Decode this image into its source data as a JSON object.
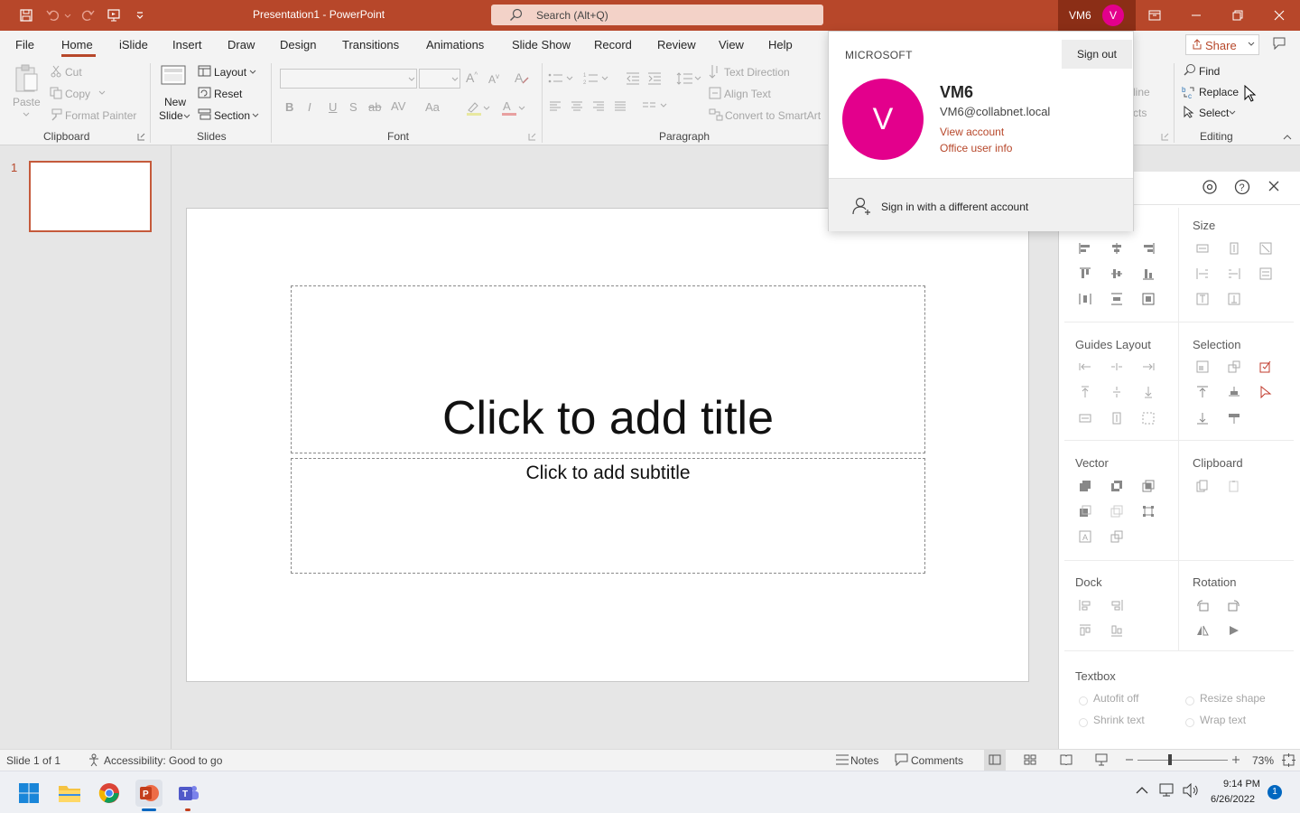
{
  "titlebar": {
    "doc_title": "Presentation1  -  PowerPoint",
    "search_placeholder": "Search (Alt+Q)",
    "account_initials": "VM6",
    "avatar_letter": "V",
    "accent": "#b7472a"
  },
  "tabs": [
    "File",
    "Home",
    "iSlide",
    "Insert",
    "Draw",
    "Design",
    "Transitions",
    "Animations",
    "Slide Show",
    "Record",
    "Review",
    "View",
    "Help"
  ],
  "share_label": "Share",
  "ribbon": {
    "clipboard": {
      "paste": "Paste",
      "cut": "Cut",
      "copy": "Copy",
      "format_painter": "Format Painter",
      "group": "Clipboard"
    },
    "slides": {
      "new_slide_1": "New",
      "new_slide_2": "Slide",
      "layout": "Layout",
      "reset": "Reset",
      "section": "Section",
      "group": "Slides"
    },
    "font": {
      "group": "Font",
      "bold": "B",
      "italic": "I",
      "underline": "U",
      "shadow": "S",
      "strike": "ab",
      "spacing": "AV",
      "case": "Aa"
    },
    "paragraph": {
      "text_direction": "Text Direction",
      "align_text": "Align Text",
      "convert_smartart": "Convert to SmartArt",
      "group": "Paragraph"
    },
    "drawing": {
      "line": "line",
      "effects": "cts"
    },
    "editing": {
      "find": "Find",
      "replace": "Replace",
      "select": "Select",
      "group": "Editing"
    }
  },
  "slide_pane": {
    "number": "1"
  },
  "slide": {
    "title_placeholder": "Click to add title",
    "subtitle_placeholder": "Click to add subtitle"
  },
  "panel": {
    "size": "Size",
    "guides_layout": "Guides Layout",
    "selection": "Selection",
    "vector": "Vector",
    "clipboard": "Clipboard",
    "dock": "Dock",
    "rotation": "Rotation",
    "textbox": "Textbox",
    "autofit_off": "Autofit off",
    "resize_shape": "Resize shape",
    "shrink_text": "Shrink text",
    "wrap_text": "Wrap text"
  },
  "account_popup": {
    "brand": "MICROSOFT",
    "sign_out": "Sign out",
    "avatar_letter": "V",
    "name": "VM6",
    "email": "VM6@collabnet.local",
    "view_account": "View account",
    "office_user_info": "Office user info",
    "sign_in_different": "Sign in with a different account",
    "avatar_color": "#e3008c"
  },
  "status": {
    "slide_of": "Slide 1 of 1",
    "accessibility": "Accessibility: Good to go",
    "notes": "Notes",
    "comments": "Comments",
    "zoom": "73%"
  },
  "taskbar": {
    "time": "9:14 PM",
    "date": "6/26/2022",
    "notification_count": "1"
  }
}
